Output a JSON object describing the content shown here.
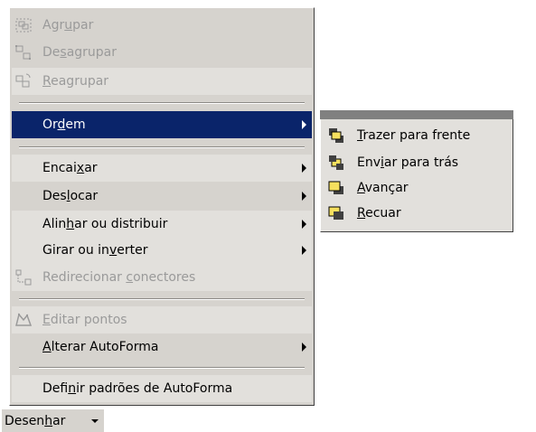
{
  "menu": {
    "agrupar": {
      "pre": "Agr",
      "key": "u",
      "post": "par"
    },
    "desagrupar": {
      "pre": "De",
      "key": "s",
      "post": "agrupar"
    },
    "reagrupar": {
      "pre": "",
      "key": "R",
      "post": "eagrupar"
    },
    "ordem": {
      "pre": "Or",
      "key": "d",
      "post": "em"
    },
    "encaixar": {
      "pre": "Encai",
      "key": "x",
      "post": "ar"
    },
    "deslocar": {
      "pre": "Des",
      "key": "l",
      "post": "ocar"
    },
    "alinhar": {
      "pre": "Alin",
      "key": "h",
      "post": "ar ou distribuir"
    },
    "girar": {
      "pre": "Girar ou in",
      "key": "v",
      "post": "erter"
    },
    "redirecionar": {
      "pre": "Redirecionar ",
      "key": "c",
      "post": "onectores"
    },
    "editar_pontos": {
      "pre": "",
      "key": "E",
      "post": "ditar pontos"
    },
    "alterar_autoforma": {
      "pre": "",
      "key": "A",
      "post": "lterar AutoForma"
    },
    "definir_padroes": {
      "pre": "Defi",
      "key": "n",
      "post": "ir padrões de AutoForma"
    }
  },
  "submenu": {
    "trazer": {
      "pre": "",
      "key": "T",
      "post": "razer para frente"
    },
    "enviar": {
      "pre": "Env",
      "key": "i",
      "post": "ar para trás"
    },
    "avancar": {
      "pre": "",
      "key": "A",
      "post": "vançar"
    },
    "recuar": {
      "pre": "",
      "key": "R",
      "post": "ecuar"
    }
  },
  "toolbar": {
    "desenhar": {
      "pre": "Desen",
      "key": "h",
      "post": "ar"
    }
  },
  "colors": {
    "menu_bg": "#d6d3ce",
    "highlight": "#0a246a",
    "disabled": "#9a9a9a"
  },
  "icons": [
    "group-icon",
    "ungroup-icon",
    "regroup-icon",
    "connector-icon",
    "edit-points-icon",
    "bring-to-front-icon",
    "send-to-back-icon",
    "bring-forward-icon",
    "send-backward-icon"
  ]
}
